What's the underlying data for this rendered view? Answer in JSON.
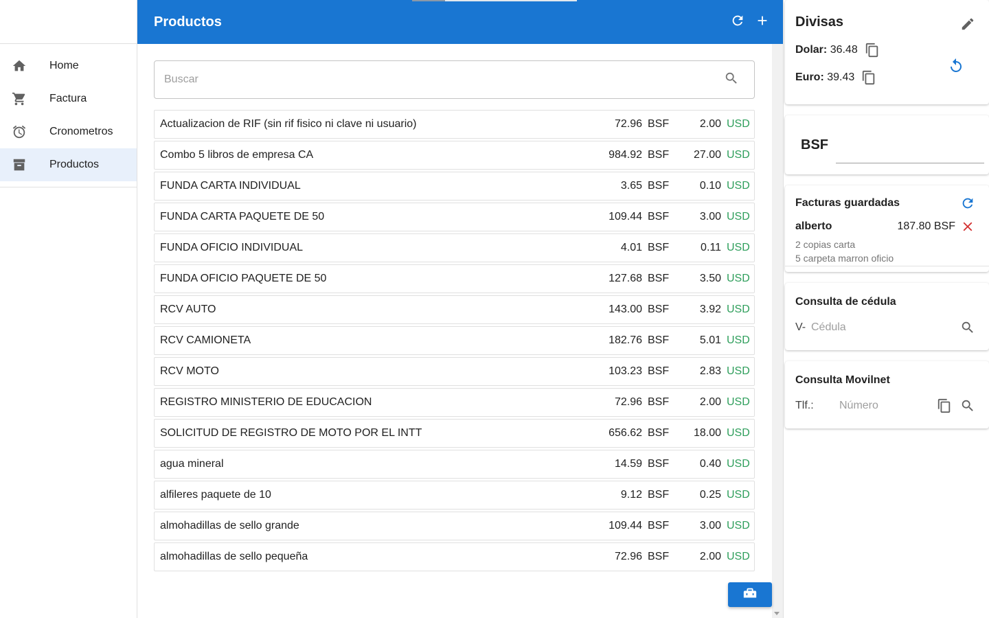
{
  "sidebar": {
    "items": [
      {
        "label": "Home",
        "icon": "home-icon"
      },
      {
        "label": "Factura",
        "icon": "cart-icon"
      },
      {
        "label": "Cronometros",
        "icon": "alarm-icon"
      },
      {
        "label": "Productos",
        "icon": "archive-icon",
        "active": true
      }
    ]
  },
  "topbar": {
    "title": "Productos"
  },
  "search": {
    "placeholder": "Buscar",
    "value": ""
  },
  "products": [
    {
      "name": "Actualizacion de RIF (sin rif fisico ni clave ni usuario)",
      "bsf": "72.96",
      "usd": "2.00"
    },
    {
      "name": "Combo 5 libros de empresa CA",
      "bsf": "984.92",
      "usd": "27.00"
    },
    {
      "name": "FUNDA CARTA INDIVIDUAL",
      "bsf": "3.65",
      "usd": "0.10"
    },
    {
      "name": "FUNDA CARTA PAQUETE DE 50",
      "bsf": "109.44",
      "usd": "3.00"
    },
    {
      "name": "FUNDA OFICIO INDIVIDUAL",
      "bsf": "4.01",
      "usd": "0.11"
    },
    {
      "name": "FUNDA OFICIO PAQUETE DE 50",
      "bsf": "127.68",
      "usd": "3.50"
    },
    {
      "name": "RCV AUTO",
      "bsf": "143.00",
      "usd": "3.92"
    },
    {
      "name": "RCV CAMIONETA",
      "bsf": "182.76",
      "usd": "5.01"
    },
    {
      "name": "RCV MOTO",
      "bsf": "103.23",
      "usd": "2.83"
    },
    {
      "name": "REGISTRO MINISTERIO DE EDUCACION",
      "bsf": "72.96",
      "usd": "2.00"
    },
    {
      "name": "SOLICITUD DE REGISTRO DE MOTO POR EL INTT",
      "bsf": "656.62",
      "usd": "18.00"
    },
    {
      "name": "agua mineral",
      "bsf": "14.59",
      "usd": "0.40"
    },
    {
      "name": "alfileres paquete de 10",
      "bsf": "9.12",
      "usd": "0.25"
    },
    {
      "name": "almohadillas de sello grande",
      "bsf": "109.44",
      "usd": "3.00"
    },
    {
      "name": "almohadillas de sello pequeña",
      "bsf": "72.96",
      "usd": "2.00"
    }
  ],
  "currency_labels": {
    "bsf": "BSF",
    "usd": "USD"
  },
  "divisas": {
    "title": "Divisas",
    "dolar_label": "Dolar:",
    "dolar_value": "36.48",
    "euro_label": "Euro:",
    "euro_value": "39.43"
  },
  "bsf_card": {
    "label": "BSF"
  },
  "facturas": {
    "title": "Facturas guardadas",
    "items": [
      {
        "name": "alberto",
        "total": "187.80 BSF",
        "lines": [
          "2 copias carta",
          "5 carpeta marron oficio"
        ]
      }
    ]
  },
  "cedula": {
    "title": "Consulta de cédula",
    "prefix": "V-",
    "placeholder": "Cédula"
  },
  "movilnet": {
    "title": "Consulta Movilnet",
    "prefix": "Tlf.:",
    "placeholder": "Número"
  },
  "colors": {
    "primary": "#1976d2",
    "usd_green": "#2e9e5b",
    "delete_red": "#d32f2f",
    "active_nav": "#e8f0fb"
  }
}
